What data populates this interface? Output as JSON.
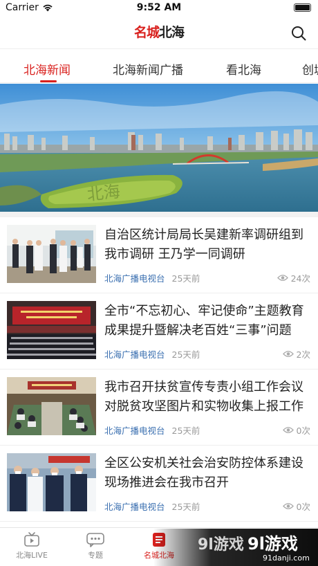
{
  "status_bar": {
    "carrier": "Carrier",
    "time": "9:52 AM"
  },
  "header": {
    "logo_part1": "名城",
    "logo_part2": "北海",
    "search_icon": "search-icon"
  },
  "tabs": [
    {
      "label": "北海新闻",
      "active": true
    },
    {
      "label": "北海新闻广播",
      "active": false
    },
    {
      "label": "看北海",
      "active": false
    },
    {
      "label": "创城",
      "active": false
    }
  ],
  "banner": {
    "ground_text": "北海"
  },
  "news": [
    {
      "title": "自治区统计局局长吴建新率调研组到我市调研 王乃学一同调研",
      "source": "北海广播电视台",
      "age": "25天前",
      "views": "24次"
    },
    {
      "title": "全市“不忘初心、牢记使命”主题教育成果提升暨解决老百姓“三事”问题",
      "source": "北海广播电视台",
      "age": "25天前",
      "views": "2次"
    },
    {
      "title": "我市召开扶贫宣传专责小组工作会议 对脱贫攻坚图片和实物收集上报工作",
      "source": "北海广播电视台",
      "age": "25天前",
      "views": "0次"
    },
    {
      "title": "全区公安机关社会治安防控体系建设现场推进会在我市召开",
      "source": "北海广播电视台",
      "age": "25天前",
      "views": "0次"
    }
  ],
  "bottom_nav": [
    {
      "label": "北海LIVE",
      "icon": "tv-icon",
      "active": false
    },
    {
      "label": "专题",
      "icon": "chat-icon",
      "active": false
    },
    {
      "label": "名城北海",
      "icon": "news-icon",
      "active": true
    }
  ],
  "watermark": {
    "text": "9l游戏",
    "site": "91danji.com"
  },
  "colors": {
    "accent": "#d9211e",
    "source_blue": "#3a6fb0",
    "meta_gray": "#999999"
  }
}
